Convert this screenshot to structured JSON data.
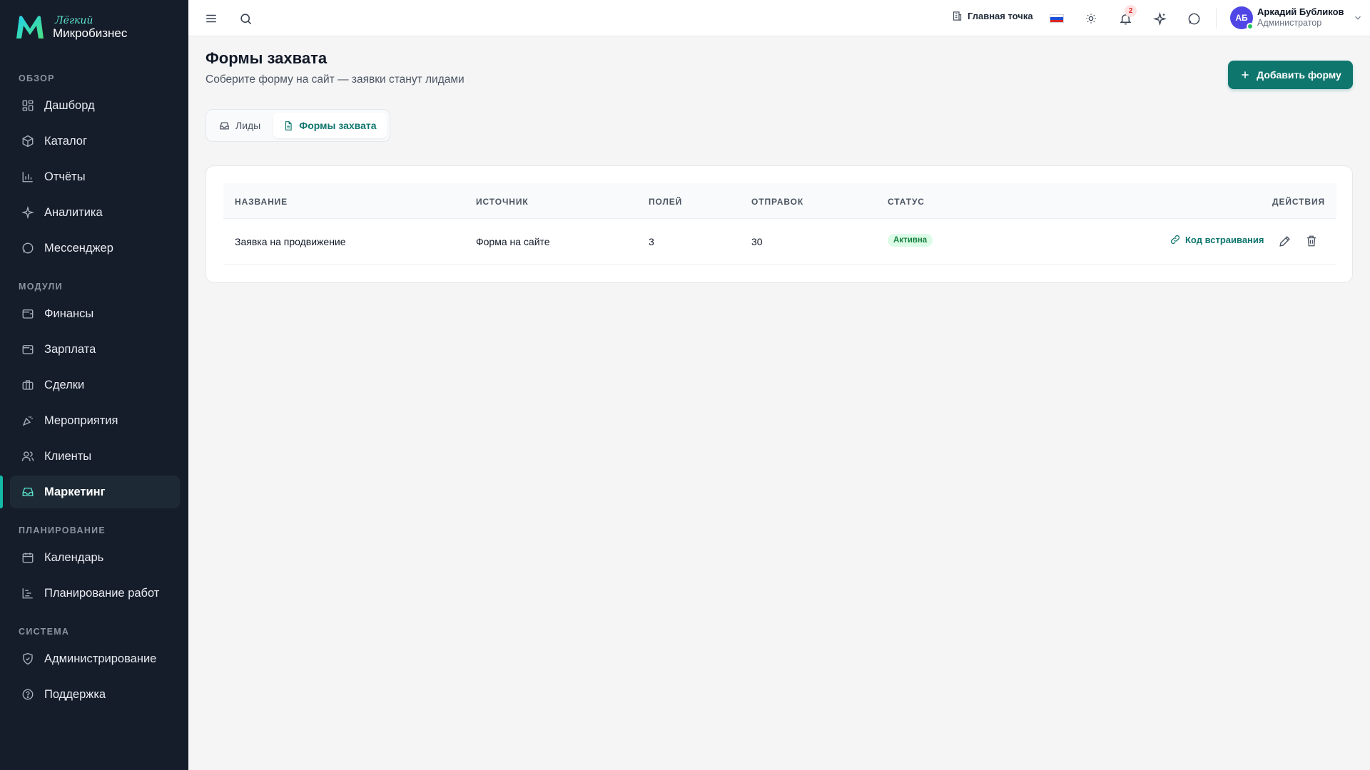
{
  "brand": {
    "top": "Лёгкий",
    "bottom": "Микробизнес"
  },
  "sidebar": {
    "sections": [
      {
        "title": "ОБЗОР",
        "items": [
          {
            "label": "Дашборд",
            "icon": "dashboard-icon"
          },
          {
            "label": "Каталог",
            "icon": "catalog-icon"
          },
          {
            "label": "Отчёты",
            "icon": "reports-icon"
          },
          {
            "label": "Аналитика",
            "icon": "sparkles-icon"
          },
          {
            "label": "Мессенджер",
            "icon": "chat-icon"
          }
        ]
      },
      {
        "title": "МОДУЛИ",
        "items": [
          {
            "label": "Финансы",
            "icon": "wallet-icon"
          },
          {
            "label": "Зарплата",
            "icon": "wallet-icon"
          },
          {
            "label": "Сделки",
            "icon": "briefcase-icon"
          },
          {
            "label": "Мероприятия",
            "icon": "party-icon"
          },
          {
            "label": "Клиенты",
            "icon": "users-icon"
          },
          {
            "label": "Маркетинг",
            "icon": "inbox-icon",
            "active": true
          }
        ]
      },
      {
        "title": "ПЛАНИРОВАНИЕ",
        "items": [
          {
            "label": "Календарь",
            "icon": "calendar-icon"
          },
          {
            "label": "Планирование работ",
            "icon": "gantt-icon"
          }
        ]
      },
      {
        "title": "СИСТЕМА",
        "items": [
          {
            "label": "Администрирование",
            "icon": "shield-icon"
          },
          {
            "label": "Поддержка",
            "icon": "help-icon"
          }
        ]
      }
    ]
  },
  "header": {
    "location": "Главная точка",
    "notifications_count": "2",
    "user": {
      "initials": "АБ",
      "name": "Аркадий Бубликов",
      "role": "Администратор"
    }
  },
  "page": {
    "title": "Формы захвата",
    "subtitle": "Соберите форму на сайт — заявки станут лидами",
    "add_button": "Добавить форму"
  },
  "tabs": [
    {
      "label": "Лиды",
      "icon": "inbox-icon",
      "active": false
    },
    {
      "label": "Формы захвата",
      "icon": "document-icon",
      "active": true
    }
  ],
  "table": {
    "columns": [
      "НАЗВАНИЕ",
      "ИСТОЧНИК",
      "ПОЛЕЙ",
      "ОТПРАВОК",
      "СТАТУС",
      "ДЕЙСТВИЯ"
    ],
    "rows": [
      {
        "name": "Заявка на продвижение",
        "source": "Форма на сайте",
        "fields": "3",
        "submissions": "30",
        "status": "Активна"
      }
    ],
    "embed_label": "Код встраивания"
  },
  "colors": {
    "accent": "#0f766e",
    "sidebar_bg": "#151c2a",
    "status_active_bg": "#dcfce7",
    "status_active_fg": "#15803d"
  }
}
